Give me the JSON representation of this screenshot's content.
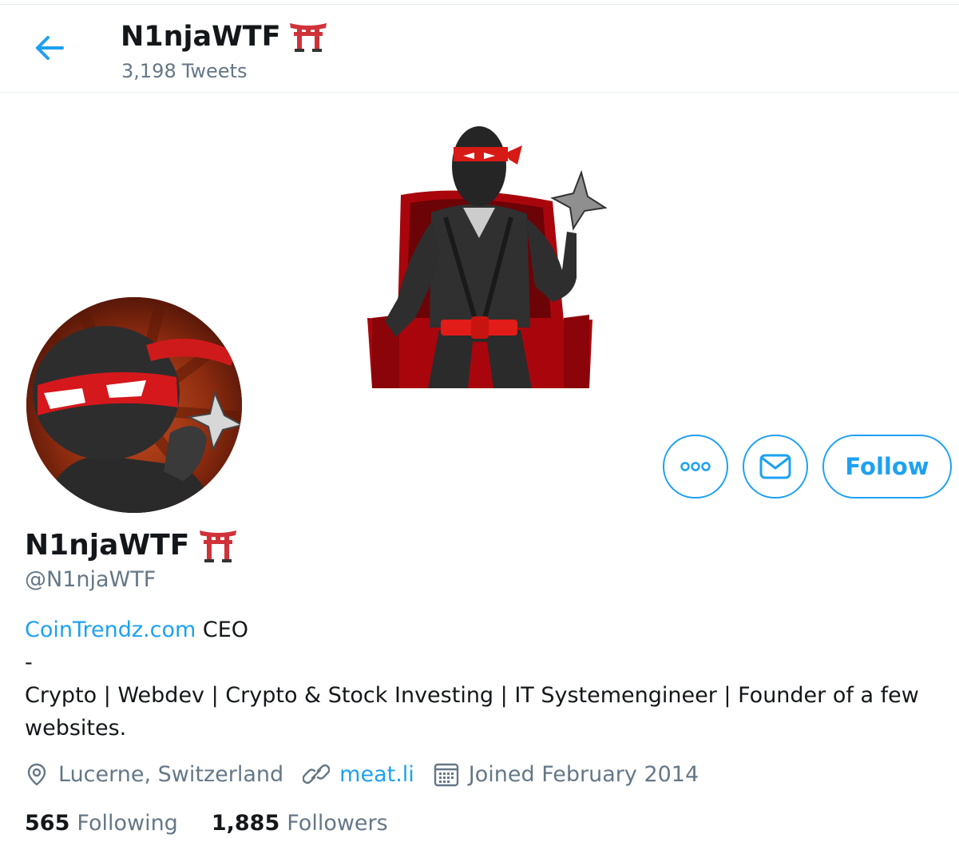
{
  "header": {
    "back_icon": "arrow-left-icon",
    "display_name": "N1njaWTF",
    "name_emoji_icon": "torii-gate-icon",
    "tweet_count": "3,198",
    "tweet_label": "Tweets"
  },
  "profile": {
    "display_name": "N1njaWTF",
    "handle": "@N1njaWTF",
    "follow_label": "Follow",
    "more_icon": "more-dots-icon",
    "message_icon": "envelope-icon"
  },
  "bio": {
    "link_text": "CoinTrendz.com",
    "after_link": " CEO",
    "separator": "-",
    "line": "Crypto | Webdev | Crypto & Stock Investing | IT Systemengineer | Founder of a few websites."
  },
  "meta": {
    "location": "Lucerne, Switzerland",
    "website": "meat.li",
    "joined": "Joined February 2014"
  },
  "stats": {
    "following_count": "565",
    "following_label": "Following",
    "followers_count": "1,885",
    "followers_label": "Followers"
  },
  "colors": {
    "accent": "#1da1f2",
    "secondary_text": "#657786",
    "torii_red": "#d0323a"
  }
}
